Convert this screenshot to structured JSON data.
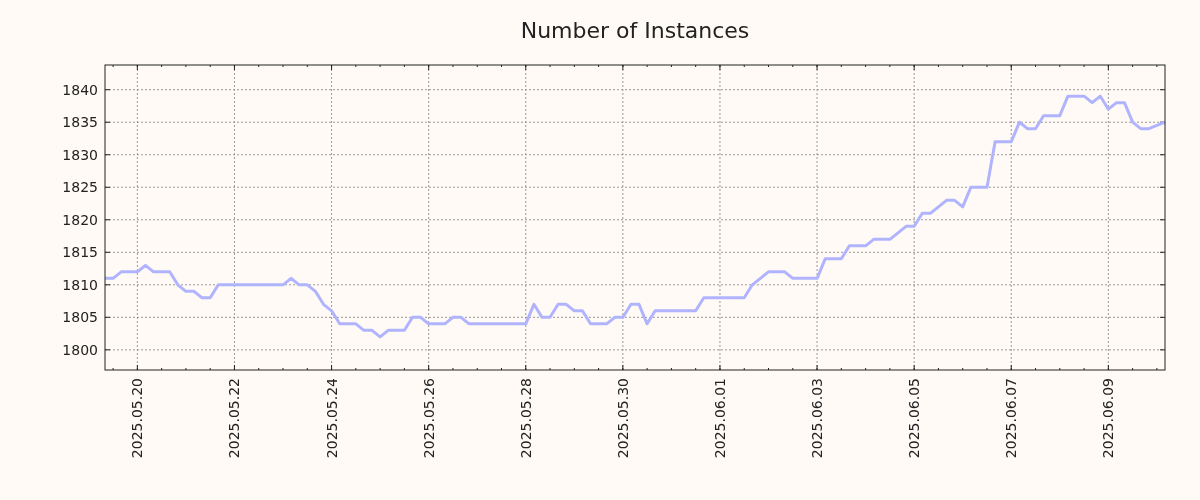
{
  "chart_data": {
    "type": "line",
    "title": "Number of Instances",
    "x": [
      "2025-05-19T08:00",
      "2025-05-19T12:00",
      "2025-05-19T16:00",
      "2025-05-20T00:00",
      "2025-05-20T04:00",
      "2025-05-20T08:00",
      "2025-05-20T16:00",
      "2025-05-20T20:00",
      "2025-05-21T00:00",
      "2025-05-21T04:00",
      "2025-05-21T08:00",
      "2025-05-21T12:00",
      "2025-05-21T16:00",
      "2025-05-23T00:00",
      "2025-05-23T04:00",
      "2025-05-23T08:00",
      "2025-05-23T12:00",
      "2025-05-23T16:00",
      "2025-05-23T20:00",
      "2025-05-24T00:00",
      "2025-05-24T04:00",
      "2025-05-24T12:00",
      "2025-05-24T16:00",
      "2025-05-24T20:00",
      "2025-05-25T00:00",
      "2025-05-25T04:00",
      "2025-05-25T12:00",
      "2025-05-25T16:00",
      "2025-05-25T20:00",
      "2025-05-26T00:00",
      "2025-05-26T08:00",
      "2025-05-26T12:00",
      "2025-05-26T16:00",
      "2025-05-26T20:00",
      "2025-05-28T00:00",
      "2025-05-28T04:00",
      "2025-05-28T08:00",
      "2025-05-28T12:00",
      "2025-05-28T16:00",
      "2025-05-28T20:00",
      "2025-05-29T00:00",
      "2025-05-29T04:00",
      "2025-05-29T08:00",
      "2025-05-29T16:00",
      "2025-05-29T20:00",
      "2025-05-30T00:00",
      "2025-05-30T04:00",
      "2025-05-30T08:00",
      "2025-05-30T12:00",
      "2025-05-30T16:00",
      "2025-05-31T12:00",
      "2025-05-31T16:00",
      "2025-06-01T12:00",
      "2025-06-01T16:00",
      "2025-06-01T20:00",
      "2025-06-02T00:00",
      "2025-06-02T08:00",
      "2025-06-02T12:00",
      "2025-06-03T00:00",
      "2025-06-03T04:00",
      "2025-06-03T12:00",
      "2025-06-03T16:00",
      "2025-06-04T00:00",
      "2025-06-04T04:00",
      "2025-06-04T12:00",
      "2025-06-04T16:00",
      "2025-06-04T20:00",
      "2025-06-05T00:00",
      "2025-06-05T04:00",
      "2025-06-05T08:00",
      "2025-06-05T16:00",
      "2025-06-05T20:00",
      "2025-06-06T00:00",
      "2025-06-06T04:00",
      "2025-06-06T12:00",
      "2025-06-06T16:00",
      "2025-06-07T00:00",
      "2025-06-07T04:00",
      "2025-06-07T08:00",
      "2025-06-07T12:00",
      "2025-06-07T16:00",
      "2025-06-08T00:00",
      "2025-06-08T04:00",
      "2025-06-08T12:00",
      "2025-06-08T16:00",
      "2025-06-08T20:00",
      "2025-06-09T00:00",
      "2025-06-09T04:00",
      "2025-06-09T08:00",
      "2025-06-09T12:00",
      "2025-06-09T16:00",
      "2025-06-09T20:00",
      "2025-06-10T04:00"
    ],
    "series": [
      {
        "color": "#b0b4ff",
        "values": [
          1811,
          1811,
          1812,
          1812,
          1813,
          1812,
          1812,
          1810,
          1809,
          1809,
          1808,
          1808,
          1810,
          1810,
          1811,
          1810,
          1810,
          1809,
          1807,
          1806,
          1804,
          1804,
          1803,
          1803,
          1802,
          1803,
          1803,
          1805,
          1805,
          1804,
          1804,
          1805,
          1805,
          1804,
          1804,
          1807,
          1805,
          1805,
          1807,
          1807,
          1806,
          1806,
          1804,
          1804,
          1805,
          1805,
          1807,
          1807,
          1804,
          1806,
          1806,
          1808,
          1808,
          1810,
          1811,
          1812,
          1812,
          1811,
          1811,
          1814,
          1814,
          1816,
          1816,
          1817,
          1817,
          1818,
          1819,
          1819,
          1821,
          1821,
          1823,
          1823,
          1822,
          1825,
          1825,
          1832,
          1832,
          1835,
          1834,
          1834,
          1836,
          1836,
          1839,
          1839,
          1838,
          1839,
          1837,
          1838,
          1838,
          1835,
          1834,
          1834,
          1835
        ]
      }
    ],
    "grid": true,
    "xlim": [
      "2025-05-19T08:00",
      "2025-06-10T04:00"
    ],
    "ylim": [
      1796.9,
      1843.8
    ],
    "xticks": [
      {
        "value": "2025-05-20",
        "label": "2025.05.20"
      },
      {
        "value": "2025-05-22",
        "label": "2025.05.22"
      },
      {
        "value": "2025-05-24",
        "label": "2025.05.24"
      },
      {
        "value": "2025-05-26",
        "label": "2025.05.26"
      },
      {
        "value": "2025-05-28",
        "label": "2025.05.28"
      },
      {
        "value": "2025-05-30",
        "label": "2025.05.30"
      },
      {
        "value": "2025-06-01",
        "label": "2025.06.01"
      },
      {
        "value": "2025-06-03",
        "label": "2025.06.03"
      },
      {
        "value": "2025-06-05",
        "label": "2025.06.05"
      },
      {
        "value": "2025-06-07",
        "label": "2025.06.07"
      },
      {
        "value": "2025-06-09",
        "label": "2025.06.09"
      }
    ],
    "yticks": [
      1800,
      1805,
      1810,
      1815,
      1820,
      1825,
      1830,
      1835,
      1840
    ]
  }
}
